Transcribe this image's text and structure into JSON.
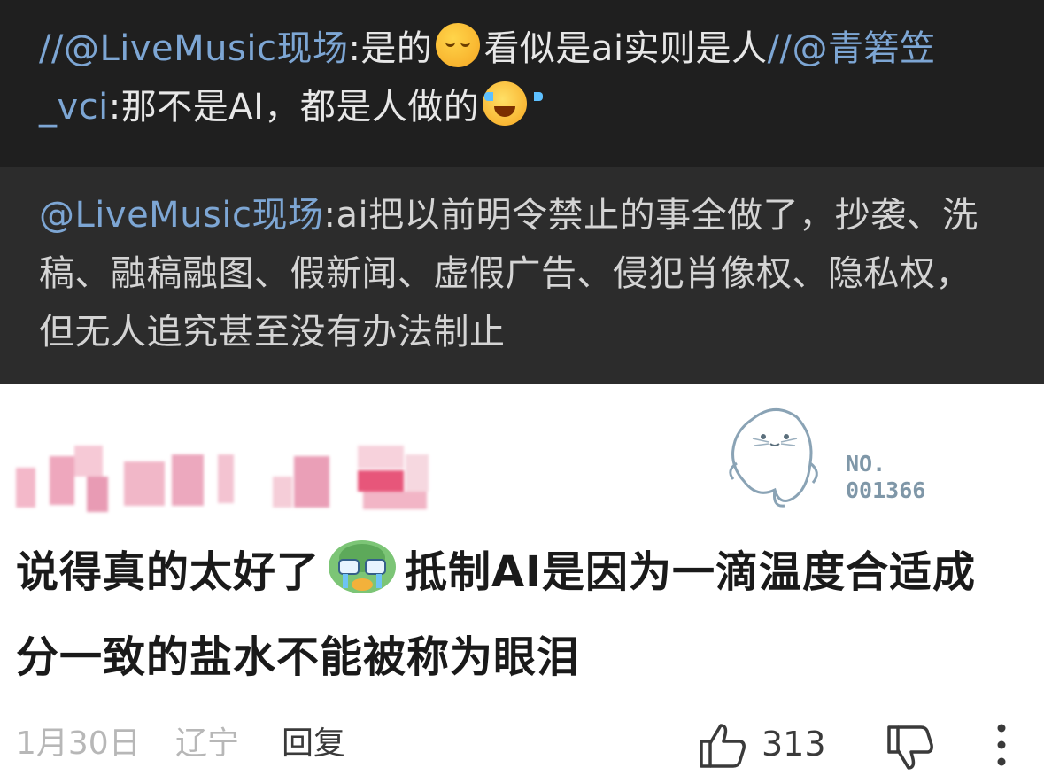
{
  "repost_top": {
    "mention_1": "//@LiveMusic现场",
    "text_1": ":是的",
    "emoji_1": "pensive-face",
    "text_2": "看似是ai实则是人",
    "mention_2": "//@青箬笠_vci",
    "text_3": ":那不是AI，都是人做的",
    "emoji_2": "laughing-crying-face"
  },
  "repost_bottom": {
    "mention": "@LiveMusic现场",
    "text": ":ai把以前明令禁止的事全做了，抄袭、洗稿、融稿融图、假新闻、虚假广告、侵犯肖像权、隐私权，但无人追究甚至没有办法制止"
  },
  "comment": {
    "badge_line_1": "NO.",
    "badge_line_2": "001366",
    "text_before_sticker": "说得真的太好了",
    "sticker": "crying-duck-sticker",
    "text_after_sticker": "抵制AI是因为一滴温度合适成分一致的盐水不能被称为眼泪",
    "date": "1月30日",
    "location": "辽宁",
    "reply_label": "回复",
    "like_count": "313"
  },
  "colors": {
    "mention": "#7da6d4",
    "dark_top_bg": "#1f1f1f",
    "dark_bottom_bg": "#2c2c2c"
  }
}
